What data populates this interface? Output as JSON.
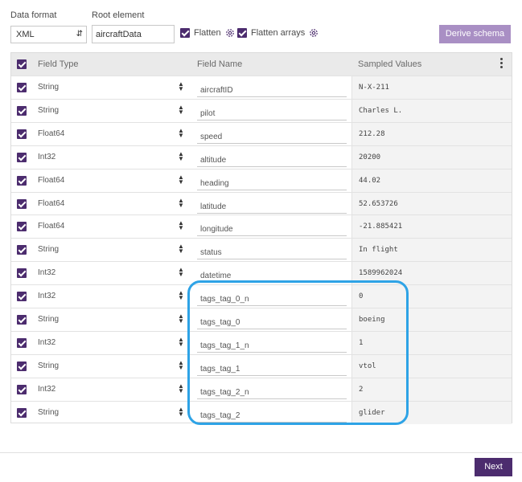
{
  "header": {
    "data_format_label": "Data format",
    "data_format_value": "XML",
    "root_element_label": "Root element",
    "root_element_value": "aircraftData",
    "flatten_label": "Flatten",
    "flatten_arrays_label": "Flatten arrays",
    "derive_schema_label": "Derive schema"
  },
  "table": {
    "columns": [
      "Field Type",
      "Field Name",
      "Sampled Values"
    ],
    "rows": [
      {
        "type": "String",
        "name": "aircraftID",
        "sample": "N-X-211"
      },
      {
        "type": "String",
        "name": "pilot",
        "sample": "Charles L."
      },
      {
        "type": "Float64",
        "name": "speed",
        "sample": "212.28"
      },
      {
        "type": "Int32",
        "name": "altitude",
        "sample": "20200"
      },
      {
        "type": "Float64",
        "name": "heading",
        "sample": "44.02"
      },
      {
        "type": "Float64",
        "name": "latitude",
        "sample": "52.653726"
      },
      {
        "type": "Float64",
        "name": "longitude",
        "sample": "-21.885421"
      },
      {
        "type": "String",
        "name": "status",
        "sample": "In flight"
      },
      {
        "type": "Int32",
        "name": "datetime",
        "sample": "1589962024"
      },
      {
        "type": "Int32",
        "name": "tags_tag_0_n",
        "sample": "0"
      },
      {
        "type": "String",
        "name": "tags_tag_0",
        "sample": "boeing"
      },
      {
        "type": "Int32",
        "name": "tags_tag_1_n",
        "sample": "1"
      },
      {
        "type": "String",
        "name": "tags_tag_1",
        "sample": "vtol"
      },
      {
        "type": "Int32",
        "name": "tags_tag_2_n",
        "sample": "2"
      },
      {
        "type": "String",
        "name": "tags_tag_2",
        "sample": "glider"
      }
    ]
  },
  "footer": {
    "next_label": "Next"
  },
  "colors": {
    "accent": "#4c2c6e",
    "derive_button": "#a98fc4",
    "highlight": "#2ea3e6"
  }
}
